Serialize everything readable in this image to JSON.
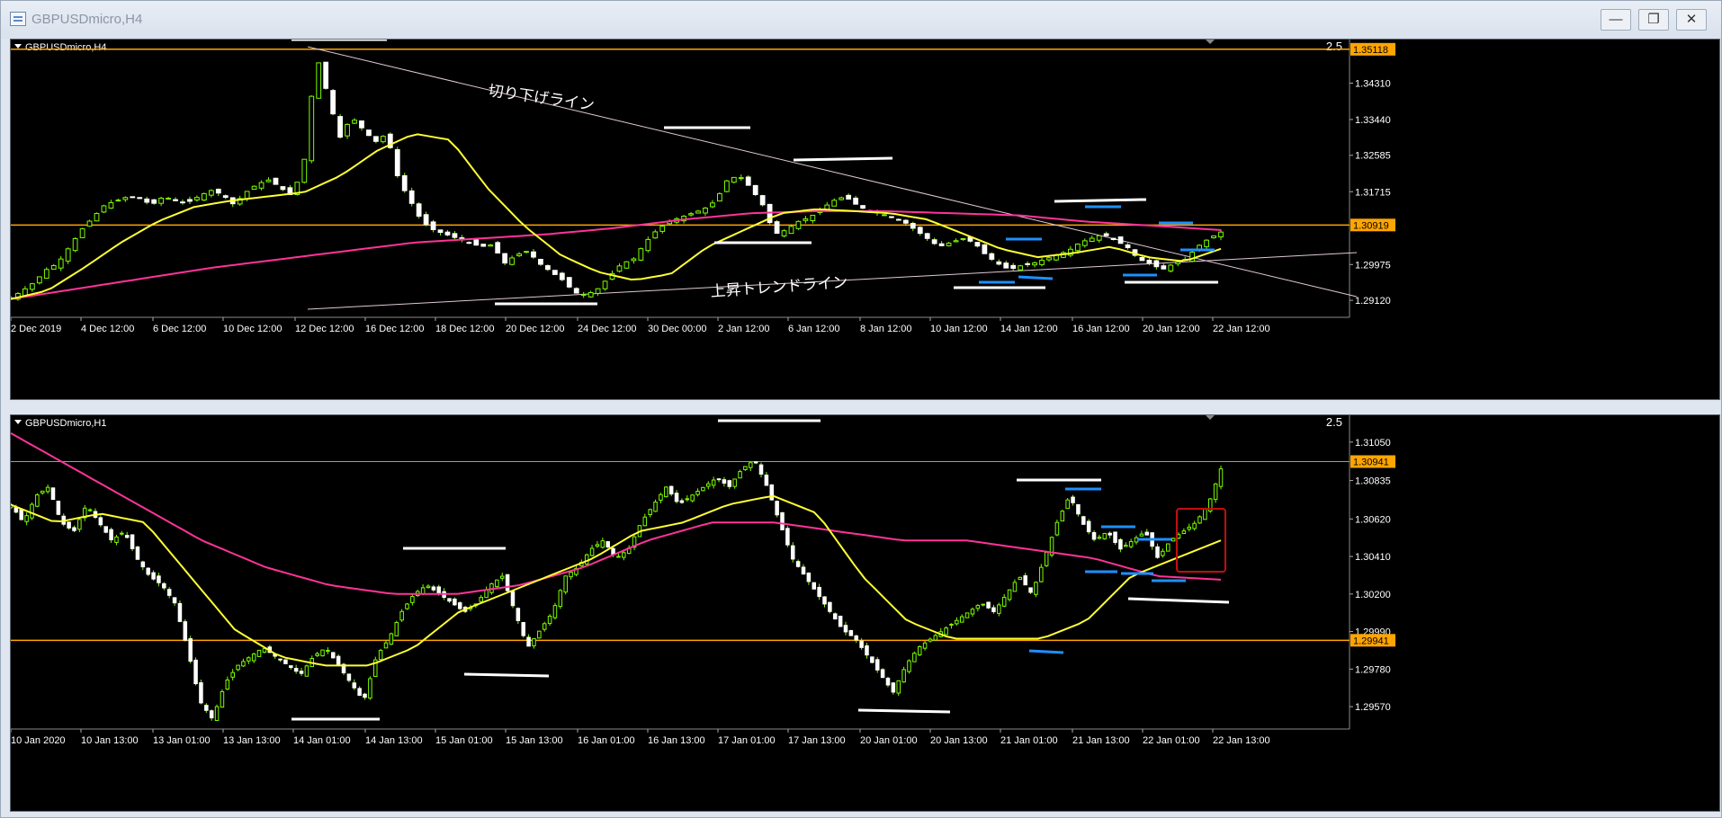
{
  "window": {
    "title": "GBPUSDmicro,H4",
    "minimize_glyph": "—",
    "restore_glyph": "❐",
    "close_glyph": "✕"
  },
  "colors": {
    "background": "#000000",
    "up_candle": "#7cfc00",
    "down_candle": "#ffffff",
    "ma_short": "#ffff33",
    "ma_long": "#ff3399",
    "level_line": "#ffa500",
    "trend_line": "#e0c8d8",
    "marker_white": "#ffffff",
    "marker_blue": "#1e90ff",
    "highlight_box": "#c01010"
  },
  "chart_data": [
    {
      "type": "candlestick",
      "symbol_label": "GBPUSDmicro,H4",
      "scale_label": "2.5",
      "y_ticks": [
        "1.35118",
        "1.34310",
        "1.33440",
        "1.32585",
        "1.31715",
        "1.30919",
        "1.29975",
        "1.29120"
      ],
      "ylim": [
        1.2895,
        1.3535
      ],
      "highlight_prices": [
        "1.35118",
        "1.30919"
      ],
      "x_ticks": [
        "2 Dec 2019",
        "4 Dec 12:00",
        "6 Dec 12:00",
        "10 Dec 12:00",
        "12 Dec 12:00",
        "16 Dec 12:00",
        "18 Dec 12:00",
        "20 Dec 12:00",
        "24 Dec 12:00",
        "30 Dec 00:00",
        "2 Jan 12:00",
        "6 Jan 12:00",
        "8 Jan 12:00",
        "10 Jan 12:00",
        "14 Jan 12:00",
        "16 Jan 12:00",
        "20 Jan 12:00",
        "22 Jan 12:00"
      ],
      "horizontal_levels": [
        1.35118,
        1.30919
      ],
      "close_path": [
        1.2918,
        1.2935,
        1.2955,
        1.2985,
        1.3,
        1.304,
        1.308,
        1.311,
        1.314,
        1.315,
        1.316,
        1.3155,
        1.314,
        1.316,
        1.315,
        1.3145,
        1.316,
        1.3175,
        1.3165,
        1.314,
        1.317,
        1.319,
        1.32,
        1.318,
        1.316,
        1.325,
        1.35,
        1.34,
        1.33,
        1.335,
        1.332,
        1.329,
        1.331,
        1.32,
        1.315,
        1.31,
        1.308,
        1.307,
        1.306,
        1.305,
        1.304,
        1.3045,
        1.3,
        1.302,
        1.303,
        1.3,
        1.298,
        1.296,
        1.293,
        1.2925,
        1.294,
        1.297,
        1.3,
        1.301,
        1.305,
        1.308,
        1.31,
        1.311,
        1.312,
        1.313,
        1.315,
        1.32,
        1.321,
        1.318,
        1.314,
        1.307,
        1.308,
        1.31,
        1.311,
        1.313,
        1.315,
        1.316,
        1.314,
        1.3125,
        1.312,
        1.311,
        1.31,
        1.308,
        1.306,
        1.304,
        1.305,
        1.306,
        1.305,
        1.302,
        1.3,
        1.2985,
        1.2995,
        1.3,
        1.301,
        1.302,
        1.303,
        1.305,
        1.306,
        1.307,
        1.3055,
        1.304,
        1.301,
        1.3,
        1.2985,
        1.3,
        1.301,
        1.304,
        1.306,
        1.3075
      ],
      "ma_short": [
        1.2915,
        1.2935,
        1.299,
        1.305,
        1.31,
        1.3135,
        1.315,
        1.316,
        1.317,
        1.321,
        1.327,
        1.331,
        1.3295,
        1.318,
        1.309,
        1.302,
        1.298,
        1.296,
        1.2975,
        1.304,
        1.308,
        1.312,
        1.313,
        1.3125,
        1.312,
        1.3105,
        1.307,
        1.3035,
        1.3015,
        1.3025,
        1.304,
        1.3015,
        1.3005,
        1.3035
      ],
      "ma_long": [
        1.2915,
        1.294,
        1.2965,
        1.299,
        1.301,
        1.303,
        1.305,
        1.306,
        1.307,
        1.3085,
        1.3105,
        1.312,
        1.3125,
        1.3125,
        1.312,
        1.3115,
        1.31,
        1.309,
        1.308
      ],
      "annotations": [
        {
          "text": "切り下げライン"
        },
        {
          "text": "上昇トレンドライン"
        }
      ]
    },
    {
      "type": "candlestick",
      "symbol_label": "GBPUSDmicro,H1",
      "scale_label": "2.5",
      "y_ticks": [
        "1.31050",
        "1.30941",
        "1.30835",
        "1.30620",
        "1.30410",
        "1.30200",
        "1.29990",
        "1.29941",
        "1.29780",
        "1.29570"
      ],
      "ylim": [
        1.295,
        1.312
      ],
      "highlight_prices": [
        "1.30941",
        "1.29941"
      ],
      "x_ticks": [
        "10 Jan 2020",
        "10 Jan 13:00",
        "13 Jan 01:00",
        "13 Jan 13:00",
        "14 Jan 01:00",
        "14 Jan 13:00",
        "15 Jan 01:00",
        "15 Jan 13:00",
        "16 Jan 01:00",
        "16 Jan 13:00",
        "17 Jan 01:00",
        "17 Jan 13:00",
        "20 Jan 01:00",
        "20 Jan 13:00",
        "21 Jan 01:00",
        "21 Jan 13:00",
        "22 Jan 01:00",
        "22 Jan 13:00"
      ],
      "horizontal_levels": [
        1.29941
      ],
      "reference_levels": [
        1.30941
      ],
      "close_path": [
        1.307,
        1.306,
        1.3075,
        1.308,
        1.306,
        1.3055,
        1.307,
        1.306,
        1.305,
        1.3055,
        1.304,
        1.303,
        1.3025,
        1.3015,
        1.299,
        1.296,
        1.295,
        1.297,
        1.298,
        1.2985,
        1.299,
        1.2985,
        1.298,
        1.2975,
        1.2985,
        1.299,
        1.298,
        1.297,
        1.296,
        1.2985,
        1.2995,
        1.301,
        1.302,
        1.3025,
        1.302,
        1.3015,
        1.301,
        1.3015,
        1.3025,
        1.303,
        1.301,
        1.299,
        1.3,
        1.301,
        1.303,
        1.3035,
        1.3045,
        1.305,
        1.304,
        1.3045,
        1.306,
        1.307,
        1.308,
        1.307,
        1.3075,
        1.308,
        1.3085,
        1.308,
        1.309,
        1.3095,
        1.308,
        1.306,
        1.304,
        1.303,
        1.302,
        1.301,
        1.3,
        1.2995,
        1.2985,
        1.2975,
        1.2965,
        1.298,
        1.299,
        1.2995,
        1.3,
        1.3005,
        1.301,
        1.3015,
        1.301,
        1.302,
        1.303,
        1.302,
        1.304,
        1.306,
        1.3075,
        1.306,
        1.305,
        1.3055,
        1.3045,
        1.305,
        1.3055,
        1.304,
        1.305,
        1.3055,
        1.306,
        1.307,
        1.309
      ],
      "ma_short": [
        1.307,
        1.306,
        1.3065,
        1.306,
        1.303,
        1.3,
        1.2985,
        1.298,
        1.298,
        1.299,
        1.301,
        1.302,
        1.303,
        1.304,
        1.3055,
        1.306,
        1.307,
        1.3075,
        1.3065,
        1.303,
        1.3005,
        1.2995,
        1.2995,
        1.2995,
        1.3005,
        1.303,
        1.304,
        1.305
      ],
      "ma_long": [
        1.311,
        1.309,
        1.307,
        1.305,
        1.3035,
        1.3025,
        1.302,
        1.302,
        1.3025,
        1.3035,
        1.305,
        1.306,
        1.306,
        1.3055,
        1.305,
        1.305,
        1.3045,
        1.304,
        1.303,
        1.3028
      ]
    }
  ]
}
